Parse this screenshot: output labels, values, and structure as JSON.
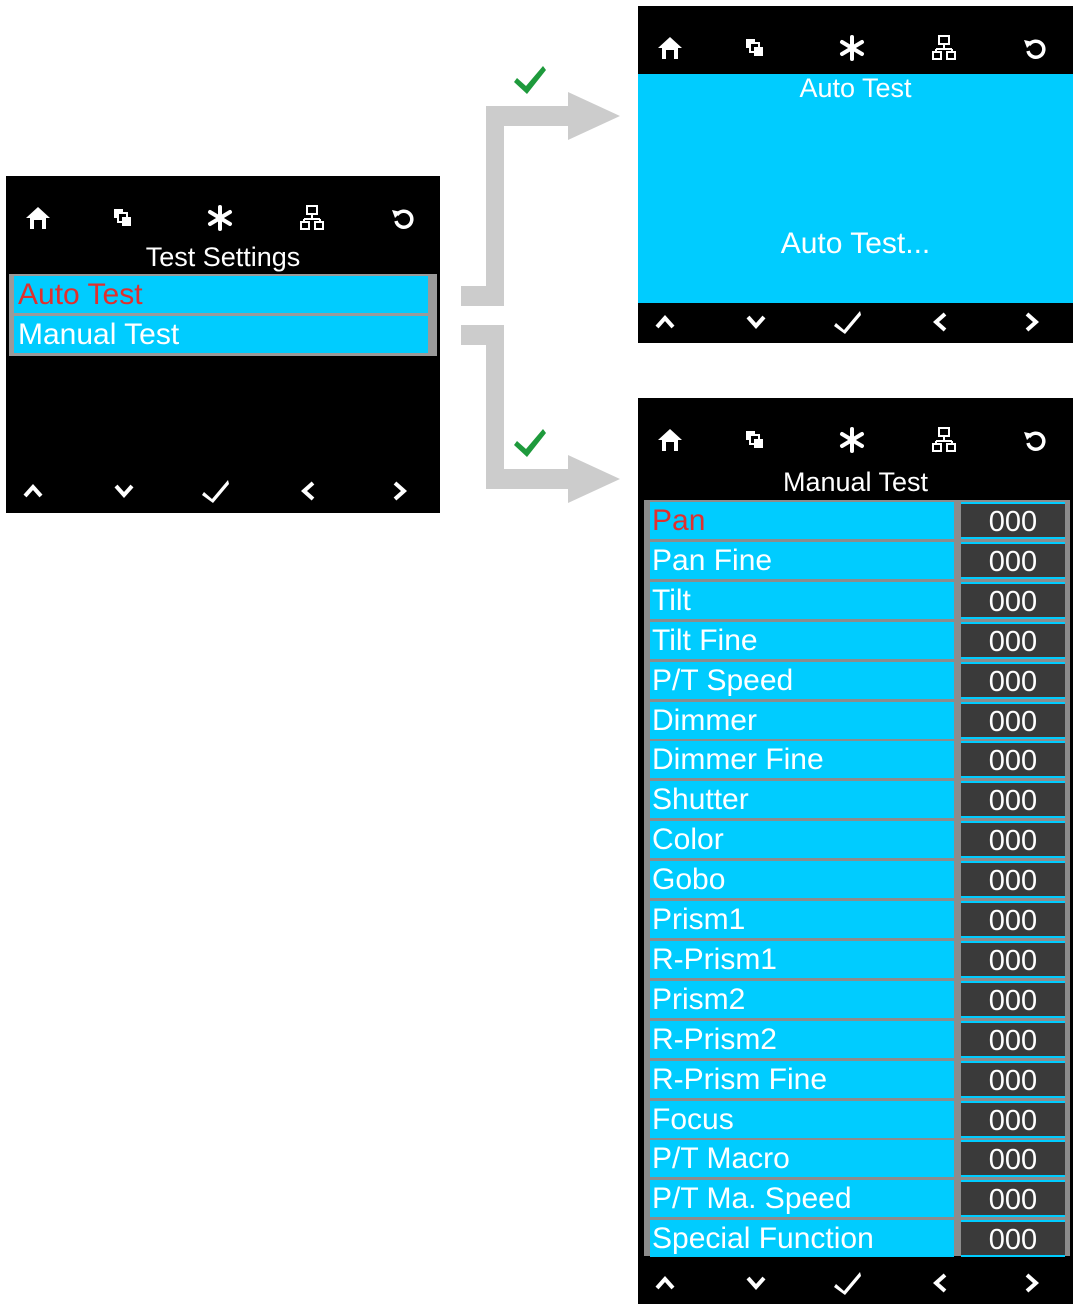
{
  "top_icons": [
    "home-icon",
    "layers-icon",
    "asterisk-icon",
    "network-icon",
    "refresh-icon"
  ],
  "bottom_icons": [
    "up-icon",
    "down-icon",
    "check-icon",
    "left-icon",
    "right-icon"
  ],
  "test_settings": {
    "title": "Test Settings",
    "items": [
      {
        "label": "Auto Test",
        "selected": true
      },
      {
        "label": "Manual Test",
        "selected": false
      }
    ]
  },
  "auto_test": {
    "title": "Auto Test",
    "message": "Auto Test..."
  },
  "manual_test": {
    "title": "Manual Test",
    "rows": [
      {
        "label": "Pan",
        "value": "000",
        "selected": true
      },
      {
        "label": "Pan Fine",
        "value": "000"
      },
      {
        "label": "Tilt",
        "value": "000"
      },
      {
        "label": "Tilt Fine",
        "value": "000"
      },
      {
        "label": "P/T Speed",
        "value": "000"
      },
      {
        "label": "Dimmer",
        "value": "000"
      },
      {
        "label": "Dimmer Fine",
        "value": "000"
      },
      {
        "label": "Shutter",
        "value": "000"
      },
      {
        "label": "Color",
        "value": "000"
      },
      {
        "label": "Gobo",
        "value": "000"
      },
      {
        "label": "Prism1",
        "value": "000"
      },
      {
        "label": "R-Prism1",
        "value": "000"
      },
      {
        "label": "Prism2",
        "value": "000"
      },
      {
        "label": "R-Prism2",
        "value": "000"
      },
      {
        "label": "R-Prism Fine",
        "value": "000"
      },
      {
        "label": "Focus",
        "value": "000"
      },
      {
        "label": "P/T Macro",
        "value": "000"
      },
      {
        "label": "P/T Ma. Speed",
        "value": "000"
      },
      {
        "label": "Special Function",
        "value": "000"
      }
    ]
  },
  "colors": {
    "accent": "#00ccff",
    "selected_text": "#e0302e",
    "check": "#1e9a3c",
    "connector": "#cccccc"
  }
}
